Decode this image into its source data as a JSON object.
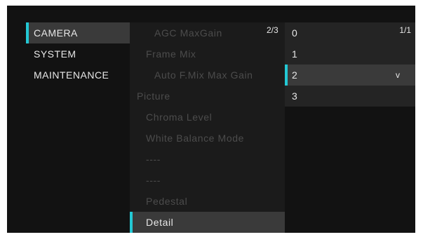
{
  "main_menu": {
    "items": [
      {
        "label": "CAMERA",
        "selected": true
      },
      {
        "label": "SYSTEM",
        "selected": false
      },
      {
        "label": "MAINTENANCE",
        "selected": false
      }
    ]
  },
  "sub_menu": {
    "page_indicator": "2/3",
    "items": [
      {
        "label": "AGC MaxGain"
      },
      {
        "label": "Frame Mix"
      },
      {
        "label": "Auto F.Mix Max Gain"
      },
      {
        "label": "Picture"
      },
      {
        "label": "Chroma Level"
      },
      {
        "label": "White Balance Mode"
      },
      {
        "label": "----"
      },
      {
        "label": "----"
      },
      {
        "label": "Pedestal"
      },
      {
        "label": "Detail",
        "selected": true
      }
    ]
  },
  "option_list": {
    "page_indicator": "1/1",
    "items": [
      {
        "label": "0"
      },
      {
        "label": "1"
      },
      {
        "label": "2",
        "selected": true,
        "indicator": "v"
      },
      {
        "label": "3"
      }
    ]
  },
  "colors": {
    "selection_accent": "#23c8d4",
    "background": "#121212",
    "highlight": "#3a3a3a"
  }
}
